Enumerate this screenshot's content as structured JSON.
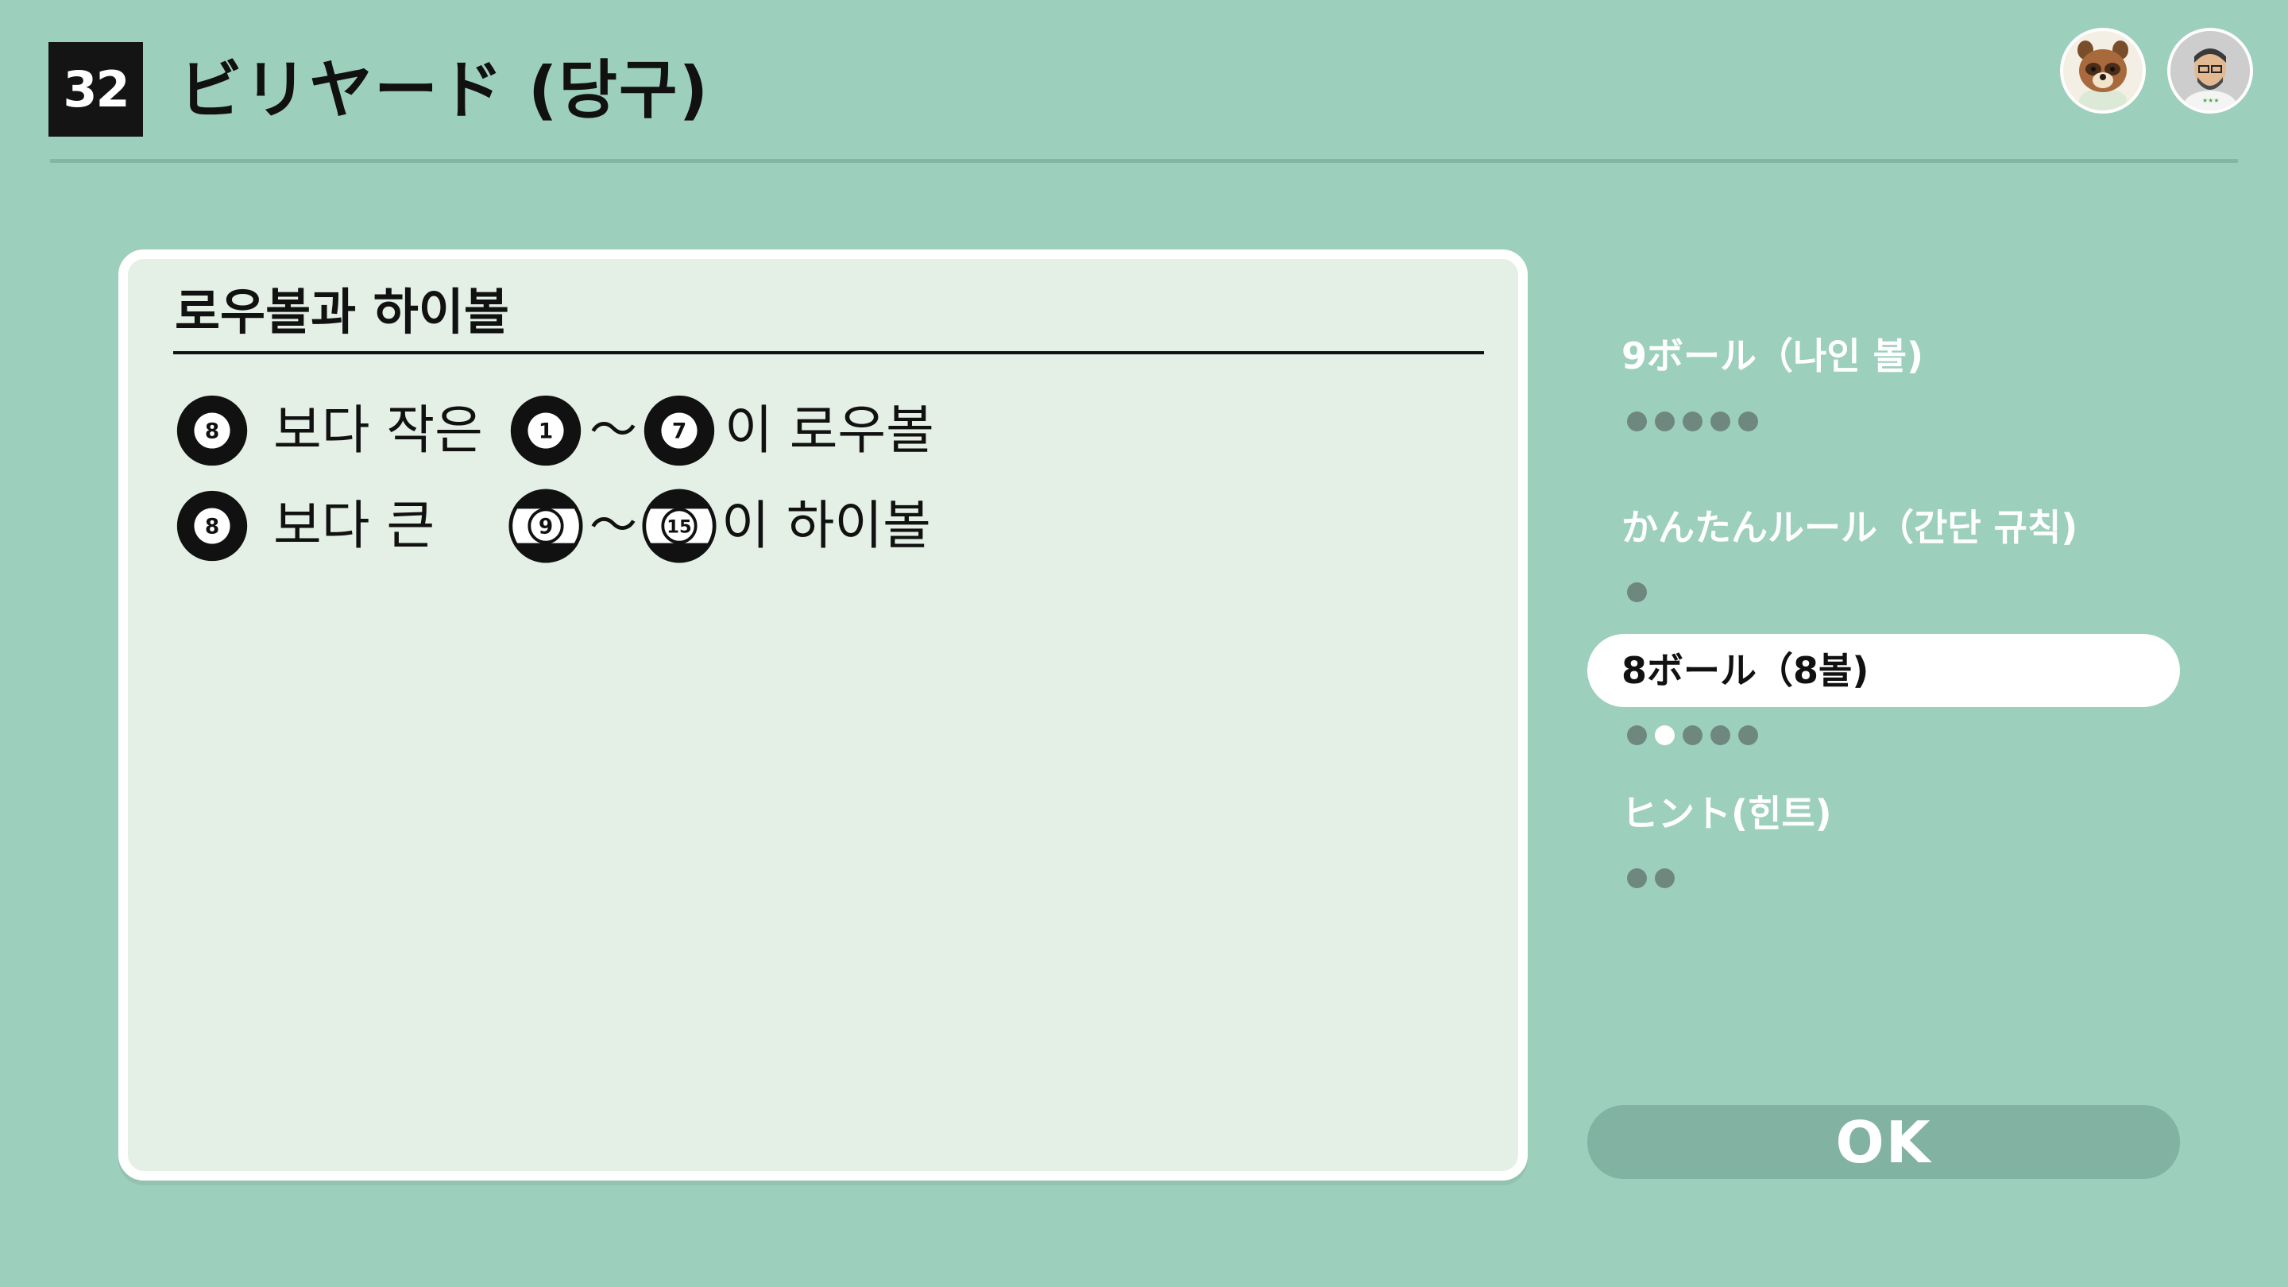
{
  "header": {
    "game_number": "32",
    "title": "ビリヤード (당구)"
  },
  "avatars": [
    "tanuki-avatar-icon",
    "mii-avatar-icon"
  ],
  "panel": {
    "heading": "로우볼과 하이볼",
    "rows": [
      {
        "ball": "8",
        "text": "보다 작은",
        "from": "1",
        "to": "7",
        "suffix": "이 로우볼",
        "ball_style": "solid"
      },
      {
        "ball": "8",
        "text": "보다 큰",
        "from": "9",
        "to": "15",
        "suffix": "이 하이볼",
        "ball_style": "stripe"
      }
    ],
    "tilde": "～"
  },
  "menu": {
    "items": [
      {
        "label": "9ボール（나인 볼)",
        "difficulty": 5,
        "progress": 0,
        "active": false
      },
      {
        "label": "かんたんルール（간단 규칙)",
        "difficulty": 1,
        "progress": 0,
        "active": false
      },
      {
        "label": "8ボール（8볼)",
        "difficulty": 5,
        "progress": 2,
        "active": true
      },
      {
        "label": "ヒント(힌트)",
        "difficulty": 2,
        "progress": 0,
        "active": false
      }
    ]
  },
  "ok_label": "OK",
  "colors": {
    "background": "#9dcfbd",
    "panel": "#e4f0e6",
    "dot_inactive": "#6e8880",
    "dot_active": "#ffffff",
    "ok_button": "#82b2a1"
  }
}
